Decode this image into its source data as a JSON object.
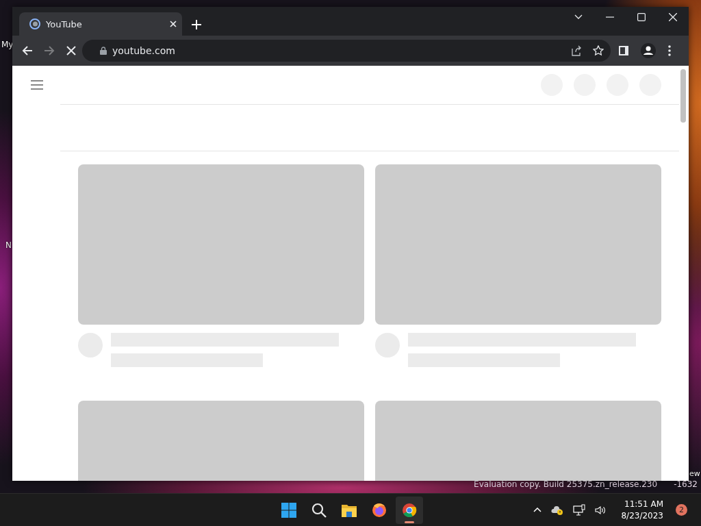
{
  "desktop": {
    "icon_labels": [
      {
        "text": "My"
      },
      {
        "text": "N"
      }
    ],
    "edition_fragment": "ew",
    "watermark": [
      "Evaluation copy. Build 25375.zn_release.230",
      "-1632"
    ]
  },
  "browser": {
    "tabs": [
      {
        "title": "YouTube",
        "selected": true
      }
    ],
    "nav_buttons": [
      {
        "kind": "back",
        "disabled": false
      },
      {
        "kind": "forward",
        "disabled": true
      },
      {
        "kind": "stop",
        "disabled": false
      }
    ],
    "address": "youtube.com"
  },
  "taskbar": {
    "apps": [
      {
        "kind": "start",
        "selected": false
      },
      {
        "kind": "search",
        "selected": false
      },
      {
        "kind": "files",
        "selected": false
      },
      {
        "kind": "firefox",
        "selected": false
      },
      {
        "kind": "chrome",
        "selected": true
      }
    ],
    "time": "11:51 AM",
    "date": "8/23/2023",
    "notification_count": "2"
  }
}
